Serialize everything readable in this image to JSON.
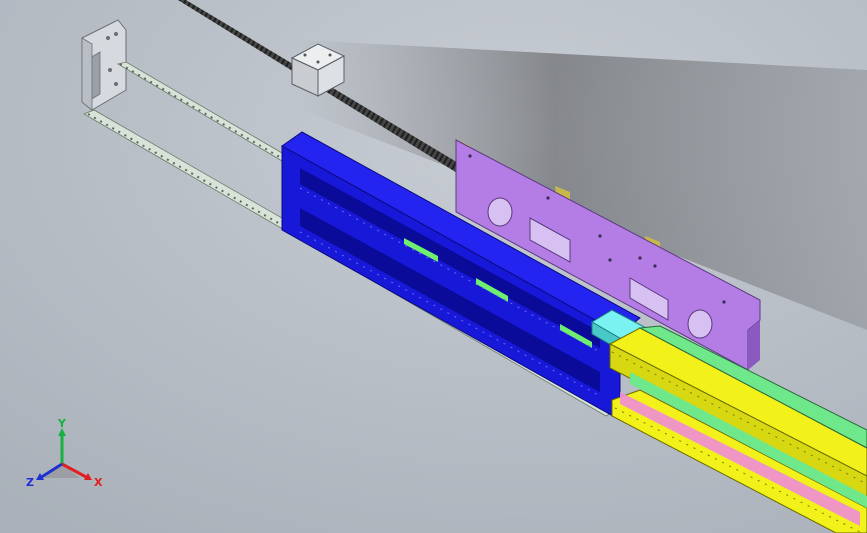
{
  "triad": {
    "x_label": "X",
    "y_label": "Y",
    "z_label": "Z",
    "x_color": "#e02020",
    "y_color": "#18b040",
    "z_color": "#2030d0"
  },
  "colors": {
    "background": "#b6bcc4",
    "bracket": "#d4d8dc",
    "rail": "#cfd8d0",
    "screw": "#3a3a3a",
    "nut_block": "#dfe2e6",
    "blue_carriage": "#1818e0",
    "blue_dark": "#0b0b9a",
    "purple_plate": "#b47de6",
    "mount_tabs": "#c8b84a",
    "cyan_block": "#5fe6e6",
    "yellow_beam": "#f2f21a",
    "green_beam": "#6ee88a",
    "pink_pockets": "#f08cd8",
    "green_window": "#6ef06e"
  }
}
